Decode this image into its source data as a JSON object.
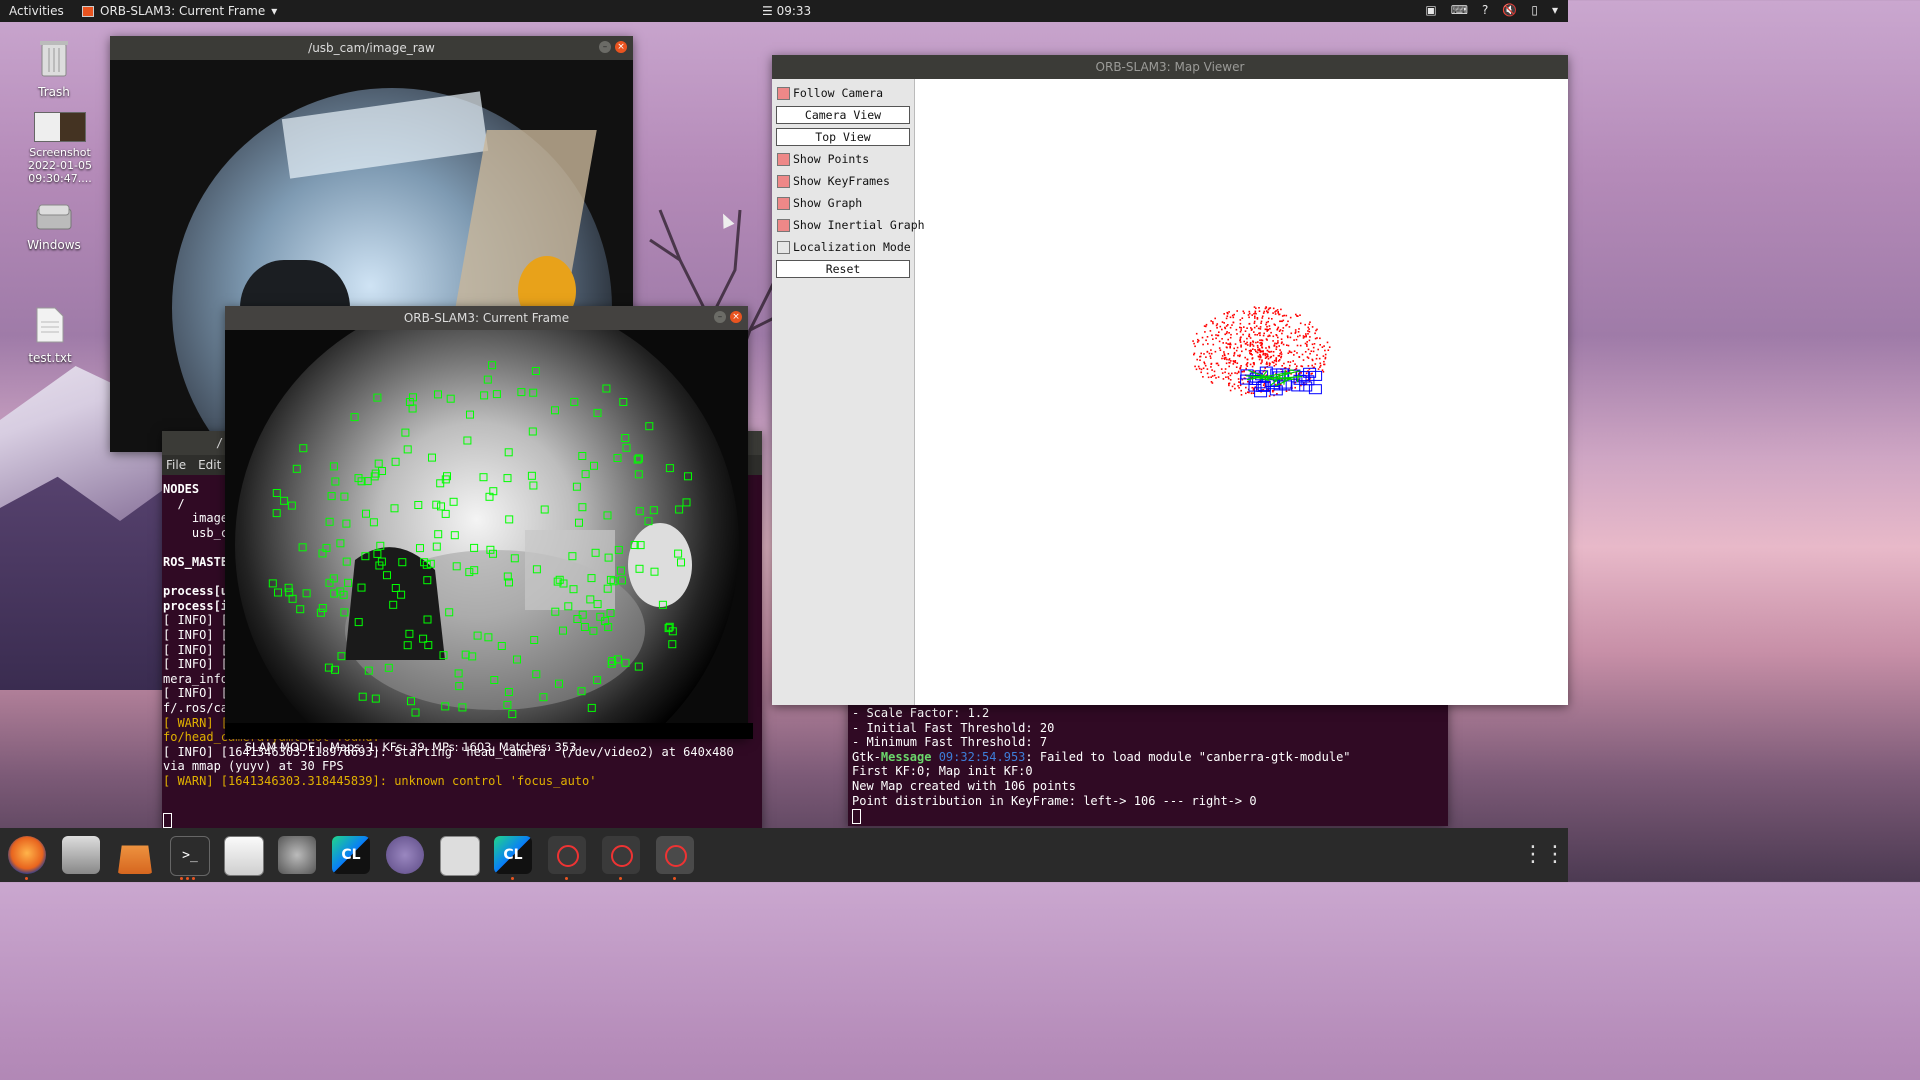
{
  "topbar": {
    "activities": "Activities",
    "app_name": "ORB-SLAM3: Current Frame",
    "clock": "09:33"
  },
  "desktop": {
    "icons": [
      {
        "label": "Trash"
      },
      {
        "label": "Screenshot 2022-01-05 09:30:47...."
      },
      {
        "label": "Windows"
      },
      {
        "label": "test.txt"
      }
    ]
  },
  "image_raw_window": {
    "title": "/usb_cam/image_raw"
  },
  "current_frame_window": {
    "title": "ORB-SLAM3: Current Frame",
    "status": "SLAM MODE |  Maps: 1, KFs: 39, MPs: 1603, Matches: 353"
  },
  "terminal_left": {
    "title": "/",
    "menu": [
      "File",
      "Edit"
    ],
    "lines": [
      {
        "text": "NODES",
        "bold": true
      },
      {
        "text": "  /"
      },
      {
        "text": "    image_"
      },
      {
        "text": "    usb_c"
      },
      {
        "text": ""
      },
      {
        "text": "ROS_MASTE",
        "bold": true
      },
      {
        "text": ""
      },
      {
        "text": "process[u",
        "bold": true
      },
      {
        "text": "process[i",
        "bold": true
      },
      {
        "text": "[ INFO] ["
      },
      {
        "text": "[ INFO] ["
      },
      {
        "text": "[ INFO] ["
      },
      {
        "text": "[ INFO] ["
      },
      {
        "text": "mera_info"
      },
      {
        "text": "[ INFO] ["
      },
      {
        "text": "f/.ros/ca"
      },
      {
        "text": "[ WARN] [",
        "warn": true
      },
      {
        "text": "fo/head_camera.yaml not found.",
        "warn": true
      },
      {
        "text": "[ INFO] [1641346303.118976693]: Starting 'head_camera' (/dev/video2) at 640x480"
      },
      {
        "text": "via mmap (yuyv) at 30 FPS"
      },
      {
        "text": "[ WARN] [1641346303.318445839]: unknown control 'focus_auto'",
        "warn": true
      }
    ]
  },
  "terminal_right": {
    "lines": [
      {
        "text": "- Scale Factor: 1.2"
      },
      {
        "text": "- Initial Fast Threshold: 20"
      },
      {
        "text": "- Minimum Fast Threshold: 7"
      },
      {
        "prefix": "Gtk-",
        "label": "Message",
        "time": " 09:32:54.953",
        "text": ": Failed to load module \"canberra-gtk-module\""
      },
      {
        "text": "First KF:0; Map init KF:0"
      },
      {
        "text": "New Map created with 106 points"
      },
      {
        "text": "Point distribution in KeyFrame: left-> 106 --- right-> 0"
      }
    ]
  },
  "map_viewer": {
    "title": "ORB-SLAM3: Map Viewer",
    "controls": {
      "follow_camera": {
        "label": "Follow Camera",
        "checked": true
      },
      "camera_view": "Camera View",
      "top_view": "Top View",
      "show_points": {
        "label": "Show Points",
        "checked": true
      },
      "show_keyframes": {
        "label": "Show KeyFrames",
        "checked": true
      },
      "show_graph": {
        "label": "Show Graph",
        "checked": true
      },
      "show_inertial_graph": {
        "label": "Show Inertial Graph",
        "checked": true
      },
      "localization_mode": {
        "label": "Localization Mode",
        "checked": false
      },
      "reset": "Reset"
    }
  },
  "dock": {
    "items": [
      "firefox-icon",
      "files-icon",
      "software-icon",
      "terminal-icon",
      "text-editor-icon",
      "settings-icon",
      "clion-icon",
      "grapes-icon",
      "camera-icon",
      "clion-icon",
      "blocked-app-icon",
      "blocked-app-icon",
      "blocked-app-icon"
    ]
  },
  "colors": {
    "accent": "#e95420",
    "terminal_bg": "#300a24",
    "feature": "#00ff00",
    "map_points": "#ff0000",
    "keyframes": "#0000ff"
  }
}
